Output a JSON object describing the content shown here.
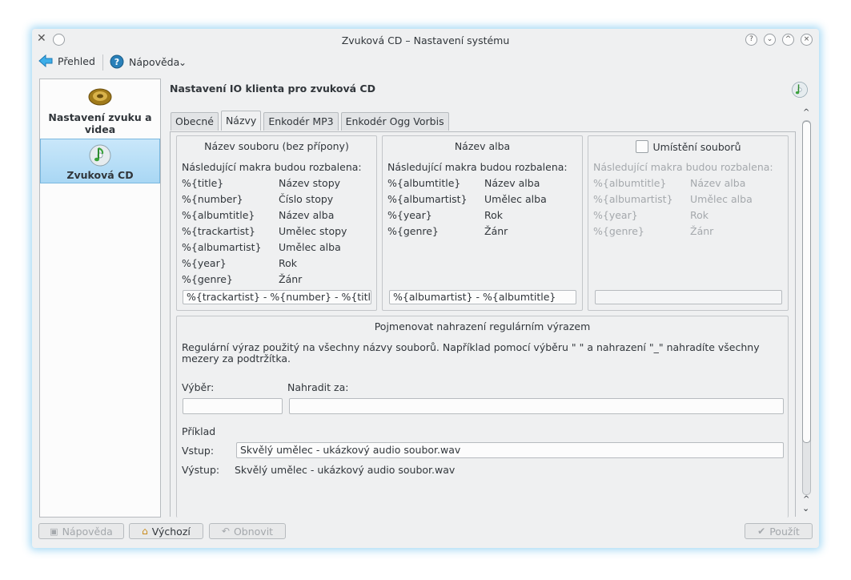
{
  "window": {
    "title": "Zvuková CD – Nastavení systému"
  },
  "toolbar": {
    "overview_label": "Přehled",
    "help_label": "Nápověda",
    "dropdown_glyph": "⌄"
  },
  "sidebar": {
    "items": [
      {
        "label": "Nastavení zvuku a videa",
        "icon": "speaker-icon"
      },
      {
        "label": "Zvuková CD",
        "icon": "audio-cd-icon"
      }
    ]
  },
  "main": {
    "title": "Nastavení IO klienta pro zvuková CD",
    "tabs": [
      {
        "label": "Obecné"
      },
      {
        "label": "Názvy"
      },
      {
        "label": "Enkodér MP3"
      },
      {
        "label": "Enkodér Ogg Vorbis"
      }
    ],
    "file_name_group": {
      "title": "Název souboru (bez přípony)",
      "macros_intro": "Následující makra budou rozbalena:",
      "macros": [
        {
          "macro": "%{title}",
          "desc": "Název stopy"
        },
        {
          "macro": "%{number}",
          "desc": "Číslo stopy"
        },
        {
          "macro": "%{albumtitle}",
          "desc": "Název alba"
        },
        {
          "macro": "%{trackartist}",
          "desc": "Umělec stopy"
        },
        {
          "macro": "%{albumartist}",
          "desc": "Umělec alba"
        },
        {
          "macro": "%{year}",
          "desc": "Rok"
        },
        {
          "macro": "%{genre}",
          "desc": "Žánr"
        }
      ],
      "value": "%{trackartist} - %{number} - %{title}"
    },
    "album_name_group": {
      "title": "Název alba",
      "macros_intro": "Následující makra budou rozbalena:",
      "macros": [
        {
          "macro": "%{albumtitle}",
          "desc": "Název alba"
        },
        {
          "macro": "%{albumartist}",
          "desc": "Umělec alba"
        },
        {
          "macro": "%{year}",
          "desc": "Rok"
        },
        {
          "macro": "%{genre}",
          "desc": "Žánr"
        }
      ],
      "value": "%{albumartist} - %{albumtitle}"
    },
    "file_location_group": {
      "title": "Umístění souborů",
      "checked": false,
      "macros_intro": "Následující makra budou rozbalena:",
      "macros": [
        {
          "macro": "%{albumtitle}",
          "desc": "Název alba"
        },
        {
          "macro": "%{albumartist}",
          "desc": "Umělec alba"
        },
        {
          "macro": "%{year}",
          "desc": "Rok"
        },
        {
          "macro": "%{genre}",
          "desc": "Žánr"
        }
      ],
      "value": ""
    },
    "regex_group": {
      "title": "Pojmenovat nahrazení regulárním výrazem",
      "description": "Regulární výraz použitý na všechny názvy souborů. Například pomocí výběru \" \" a nahrazení \"_\" nahradíte všechny mezery za podtržítka.",
      "selection_label": "Výběr:",
      "replace_label": "Nahradit za:",
      "selection_value": "",
      "replace_value": "",
      "example_label": "Příklad",
      "input_label": "Vstup:",
      "input_value": "Skvělý umělec - ukázkový audio soubor.wav",
      "output_label": "Výstup:",
      "output_value": "Skvělý umělec - ukázkový audio soubor.wav"
    }
  },
  "buttons": {
    "help": "Nápověda",
    "defaults": "Výchozí",
    "reset": "Obnovit",
    "apply": "Použít"
  }
}
